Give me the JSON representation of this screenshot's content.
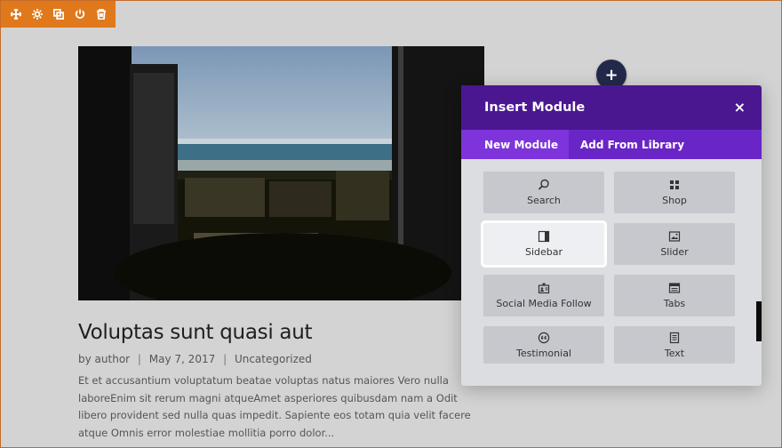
{
  "toolbar": {
    "icons": [
      "move-icon",
      "settings-icon",
      "duplicate-icon",
      "power-icon",
      "trash-icon"
    ],
    "accent": "#e0791b"
  },
  "post": {
    "title": "Voluptas sunt quasi aut",
    "meta": {
      "by": "by",
      "author": "author",
      "date": "May 7, 2017",
      "category": "Uncategorized"
    },
    "excerpt": "Et et accusantium voluptatum beatae voluptas natus maiores Vero nulla laboreEnim sit rerum magni atqueAmet asperiores quibusdam nam a Odit libero provident sed nulla quas impedit. Sapiente eos totam quia velit facere atque Omnis error molestiae mollitia porro dolor..."
  },
  "add_button": {
    "label": "+"
  },
  "modal": {
    "title": "Insert Module",
    "close": "×",
    "tabs": [
      "New Module",
      "Add From Library"
    ],
    "header_color": "#4a1791",
    "tab_color": "#6a25c7",
    "modules": [
      {
        "label": "Search",
        "icon": "search-icon"
      },
      {
        "label": "Shop",
        "icon": "grid-icon"
      },
      {
        "label": "Sidebar",
        "icon": "sidebar-icon",
        "highlighted": true
      },
      {
        "label": "Slider",
        "icon": "image-icon"
      },
      {
        "label": "Social Media Follow",
        "icon": "social-icon"
      },
      {
        "label": "Tabs",
        "icon": "tabs-icon"
      },
      {
        "label": "Testimonial",
        "icon": "quote-icon"
      },
      {
        "label": "Text",
        "icon": "text-icon"
      }
    ]
  }
}
